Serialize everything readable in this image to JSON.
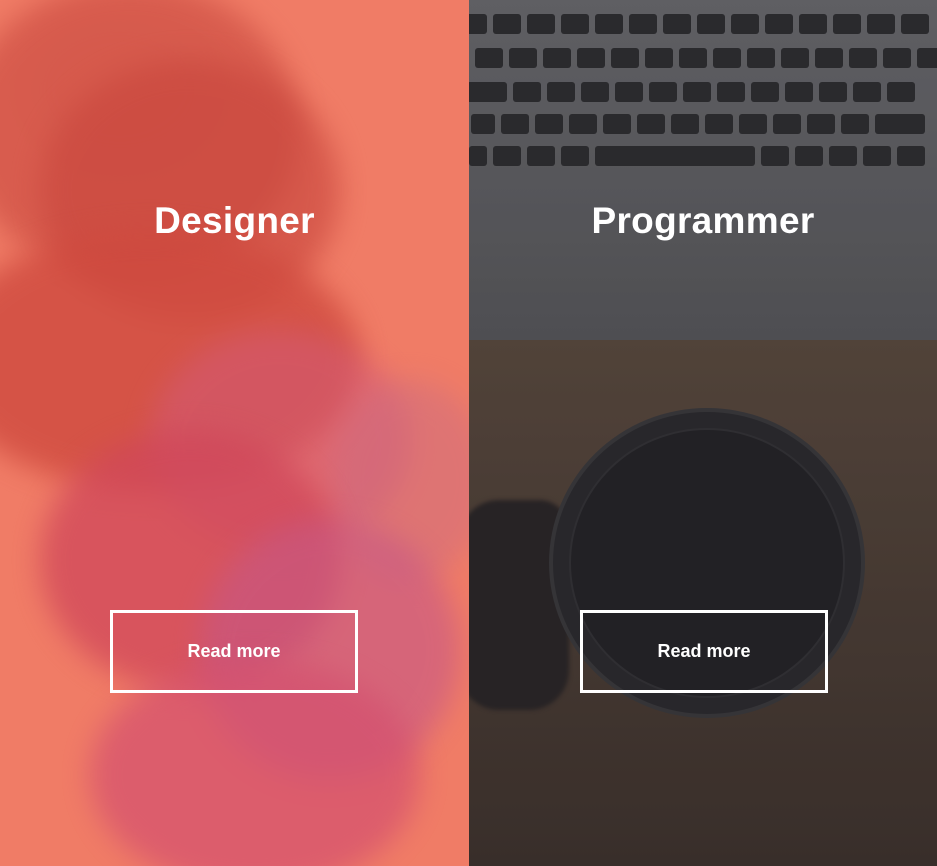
{
  "panels": {
    "designer": {
      "title": "Designer",
      "button_label": "Read more",
      "background_color": "#f07c66"
    },
    "programmer": {
      "title": "Programmer",
      "button_label": "Read more",
      "background_color": "#4a4343"
    }
  }
}
